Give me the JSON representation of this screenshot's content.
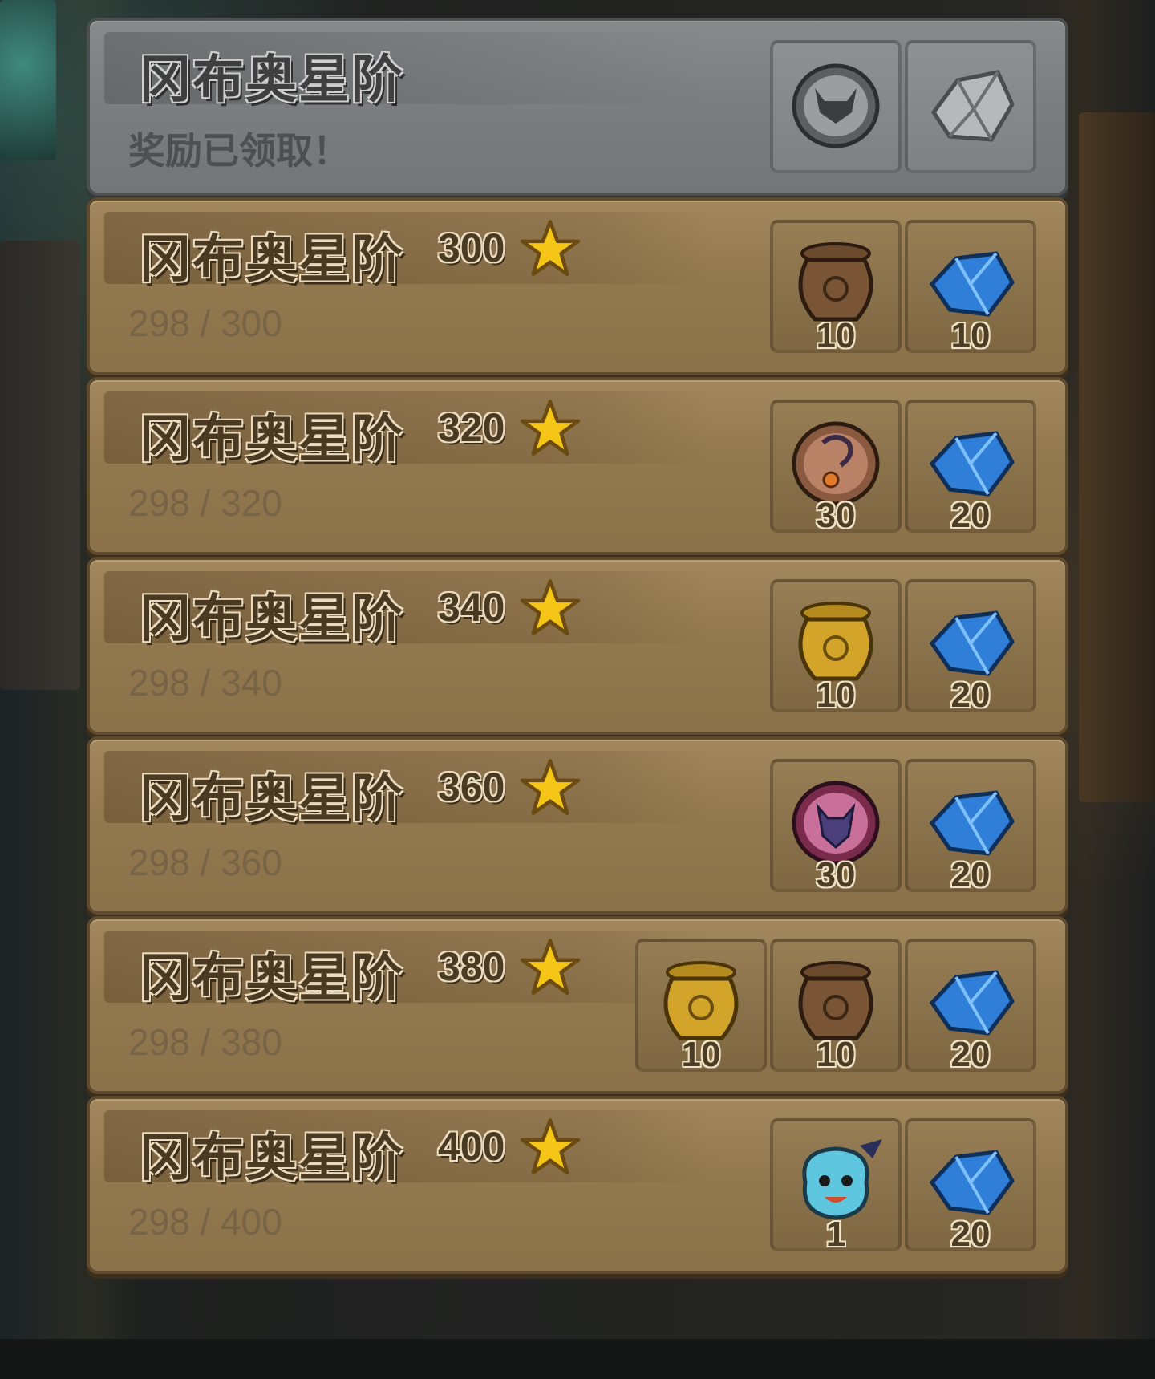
{
  "title": "冈布奥星阶",
  "claimed_row": {
    "title": "冈布奥星阶",
    "status": "奖励已领取！",
    "rewards": [
      {
        "icon": "demon-token-icon"
      },
      {
        "icon": "ore-icon"
      }
    ]
  },
  "rows": [
    {
      "title": "冈布奥星阶",
      "stars": "300",
      "progress": "298 / 300",
      "rewards": [
        {
          "icon": "bronze-urn-icon",
          "qty": "10"
        },
        {
          "icon": "blue-crystal-icon",
          "qty": "10"
        }
      ]
    },
    {
      "title": "冈布奥星阶",
      "stars": "320",
      "progress": "298 / 320",
      "rewards": [
        {
          "icon": "amulet-token-icon",
          "qty": "30"
        },
        {
          "icon": "blue-crystal-icon",
          "qty": "20"
        }
      ]
    },
    {
      "title": "冈布奥星阶",
      "stars": "340",
      "progress": "298 / 340",
      "rewards": [
        {
          "icon": "gold-urn-icon",
          "qty": "10"
        },
        {
          "icon": "blue-crystal-icon",
          "qty": "20"
        }
      ]
    },
    {
      "title": "冈布奥星阶",
      "stars": "360",
      "progress": "298 / 360",
      "rewards": [
        {
          "icon": "gumball-token-icon",
          "qty": "30"
        },
        {
          "icon": "blue-crystal-icon",
          "qty": "20"
        }
      ]
    },
    {
      "title": "冈布奥星阶",
      "stars": "380",
      "progress": "298 / 380",
      "rewards": [
        {
          "icon": "gold-urn-icon",
          "qty": "10"
        },
        {
          "icon": "bronze-urn-icon",
          "qty": "10"
        },
        {
          "icon": "blue-crystal-icon",
          "qty": "20"
        }
      ]
    },
    {
      "title": "冈布奥星阶",
      "stars": "400",
      "progress": "298 / 400",
      "rewards": [
        {
          "icon": "gumball-character-icon",
          "qty": "1"
        },
        {
          "icon": "blue-crystal-icon",
          "qty": "20"
        }
      ]
    }
  ],
  "colors": {
    "panel": "#93794f",
    "panel_claimed": "#7a7e7f",
    "star": "#f5c518",
    "crystal": "#2f7fd8"
  }
}
